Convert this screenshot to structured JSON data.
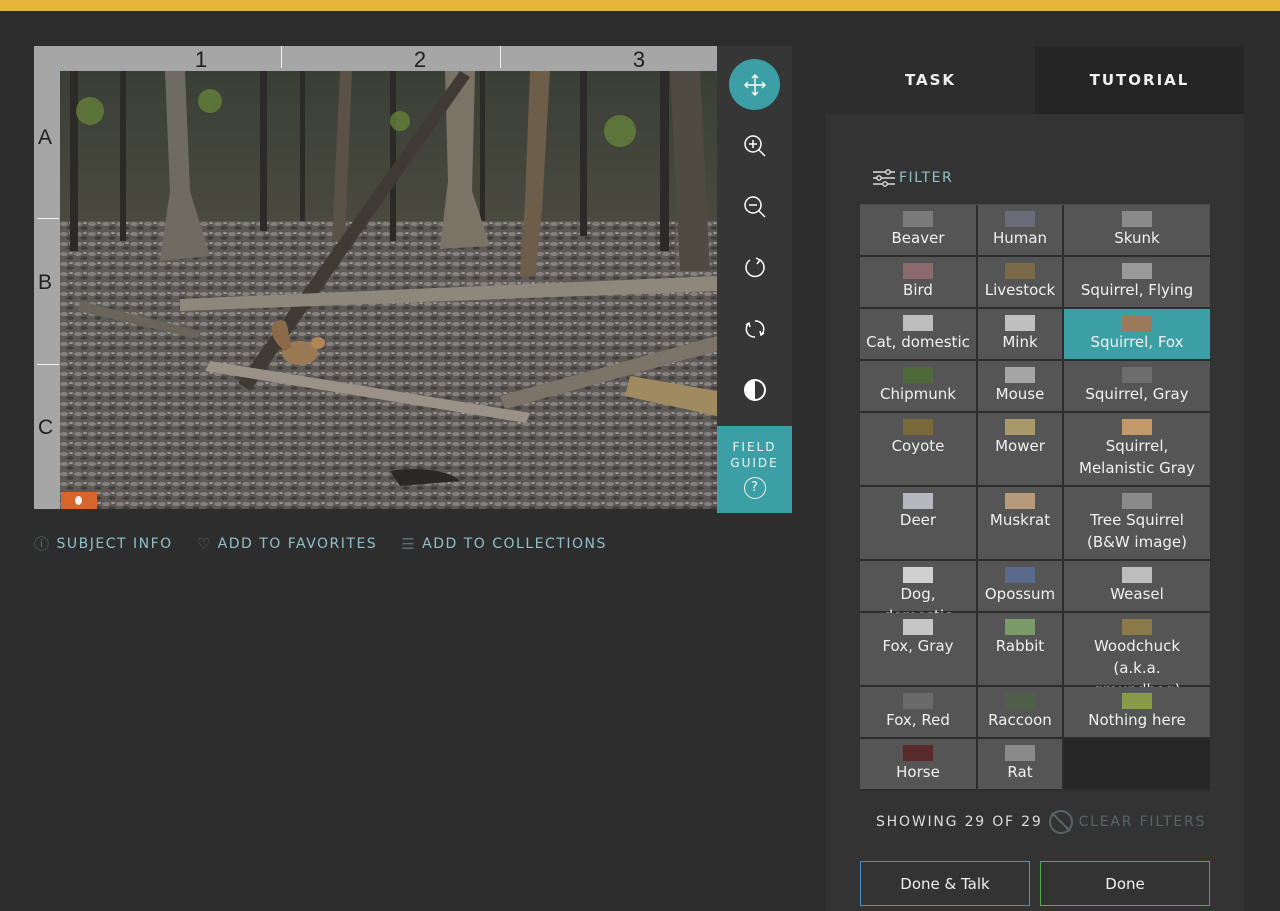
{
  "grid": {
    "columns": [
      "1",
      "2",
      "3"
    ],
    "rows": [
      "A",
      "B",
      "C"
    ]
  },
  "toolbar": {
    "tools": [
      "move-icon",
      "zoom-in-icon",
      "zoom-out-icon",
      "rotate-icon",
      "reset-icon",
      "invert-icon"
    ],
    "field_guide_line1": "FIELD",
    "field_guide_line2": "GUIDE",
    "field_guide_icon": "?"
  },
  "meta": {
    "subject_info": "SUBJECT INFO",
    "add_favorites": "ADD TO FAVORITES",
    "add_collections": "ADD TO COLLECTIONS"
  },
  "tabs": {
    "task": "TASK",
    "tutorial": "TUTORIAL"
  },
  "filter_label": "FILTER",
  "choices": [
    [
      "Beaver",
      "Human",
      "Skunk"
    ],
    [
      "Bird",
      "Livestock",
      "Squirrel, Flying"
    ],
    [
      "Cat, domestic",
      "Mink",
      "Squirrel, Fox"
    ],
    [
      "Chipmunk",
      "Mouse",
      "Squirrel, Gray"
    ],
    [
      "Coyote",
      "Mower",
      "Squirrel, Melanistic Gray"
    ],
    [
      "Deer",
      "Muskrat",
      "Tree Squirrel (B&W image)"
    ],
    [
      "Dog, domestic",
      "Opossum",
      "Weasel"
    ],
    [
      "Fox, Gray",
      "Rabbit",
      "Woodchuck (a.k.a. groundhog)"
    ],
    [
      "Fox, Red",
      "Raccoon",
      "Nothing here"
    ],
    [
      "Horse",
      "Rat",
      ""
    ]
  ],
  "selected_choice": "Squirrel, Fox",
  "showing": "SHOWING 29 OF 29",
  "clear_filters": "CLEAR FILTERS",
  "buttons": {
    "done_talk": "Done & Talk",
    "done": "Done"
  },
  "colors": {
    "accent": "#3d9fa6",
    "top_bar": "#e5b53c",
    "done_talk_border": "#4a90c8",
    "done_border": "#4cad4c"
  }
}
